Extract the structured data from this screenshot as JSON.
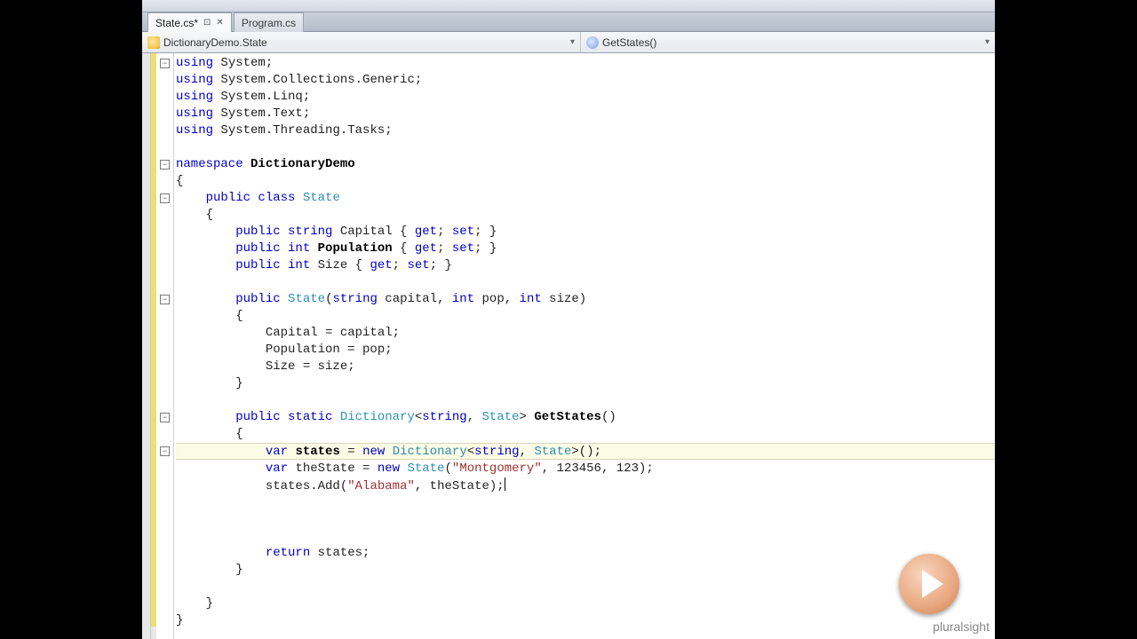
{
  "tabs": [
    {
      "label": "State.cs*",
      "active": true,
      "has_pin": true,
      "has_close": true
    },
    {
      "label": "Program.cs",
      "active": false,
      "has_pin": false,
      "has_close": false
    }
  ],
  "navbar": {
    "class_label": "DictionaryDemo.State",
    "member_label": "GetStates()"
  },
  "fold_rows": [
    0,
    6,
    8,
    14,
    21,
    23
  ],
  "changed_rows": [
    0,
    1,
    2,
    3,
    4,
    5,
    6,
    7,
    8,
    9,
    10,
    11,
    12,
    13,
    14,
    15,
    16,
    17,
    18,
    19,
    20,
    21,
    22,
    23,
    24,
    25,
    26,
    27,
    28,
    29,
    30,
    31,
    32,
    33
  ],
  "highlight_row": 23,
  "code_lines": [
    [
      [
        "kw",
        "using"
      ],
      [
        "",
        " System;"
      ]
    ],
    [
      [
        "kw",
        "using"
      ],
      [
        "",
        " System.Collections.Generic;"
      ]
    ],
    [
      [
        "kw",
        "using"
      ],
      [
        "",
        " System.Linq;"
      ]
    ],
    [
      [
        "kw",
        "using"
      ],
      [
        "",
        " System.Text;"
      ]
    ],
    [
      [
        "kw",
        "using"
      ],
      [
        "",
        " System.Threading.Tasks;"
      ]
    ],
    [
      [
        "",
        ""
      ]
    ],
    [
      [
        "kw",
        "namespace"
      ],
      [
        "",
        " "
      ],
      [
        "nm",
        "DictionaryDemo"
      ]
    ],
    [
      [
        "",
        "{"
      ]
    ],
    [
      [
        "",
        "    "
      ],
      [
        "kw",
        "public class"
      ],
      [
        "",
        " "
      ],
      [
        "type",
        "State"
      ]
    ],
    [
      [
        "",
        "    {"
      ]
    ],
    [
      [
        "",
        "        "
      ],
      [
        "kw",
        "public string"
      ],
      [
        "",
        " Capital { "
      ],
      [
        "kw",
        "get"
      ],
      [
        "",
        "; "
      ],
      [
        "kw",
        "set"
      ],
      [
        "",
        "; }"
      ]
    ],
    [
      [
        "",
        "        "
      ],
      [
        "kw",
        "public int"
      ],
      [
        "",
        " "
      ],
      [
        "nm",
        "Population"
      ],
      [
        "",
        " { "
      ],
      [
        "kw",
        "get"
      ],
      [
        "",
        "; "
      ],
      [
        "kw",
        "set"
      ],
      [
        "",
        "; }"
      ]
    ],
    [
      [
        "",
        "        "
      ],
      [
        "kw",
        "public int"
      ],
      [
        "",
        " Size { "
      ],
      [
        "kw",
        "get"
      ],
      [
        "",
        "; "
      ],
      [
        "kw",
        "set"
      ],
      [
        "",
        "; }"
      ]
    ],
    [
      [
        "",
        ""
      ]
    ],
    [
      [
        "",
        "        "
      ],
      [
        "kw",
        "public"
      ],
      [
        "",
        " "
      ],
      [
        "type",
        "State"
      ],
      [
        "",
        "("
      ],
      [
        "kw",
        "string"
      ],
      [
        "",
        " capital, "
      ],
      [
        "kw",
        "int"
      ],
      [
        "",
        " pop, "
      ],
      [
        "kw",
        "int"
      ],
      [
        "",
        " size)"
      ]
    ],
    [
      [
        "",
        "        {"
      ]
    ],
    [
      [
        "",
        "            Capital = capital;"
      ]
    ],
    [
      [
        "",
        "            Population = pop;"
      ]
    ],
    [
      [
        "",
        "            Size = size;"
      ]
    ],
    [
      [
        "",
        "        }"
      ]
    ],
    [
      [
        "",
        ""
      ]
    ],
    [
      [
        "",
        "        "
      ],
      [
        "kw",
        "public static"
      ],
      [
        "",
        " "
      ],
      [
        "type",
        "Dictionary"
      ],
      [
        "",
        "<"
      ],
      [
        "kw",
        "string"
      ],
      [
        "",
        ", "
      ],
      [
        "type",
        "State"
      ],
      [
        "",
        "> "
      ],
      [
        "nm",
        "GetStates"
      ],
      [
        "",
        "()"
      ]
    ],
    [
      [
        "",
        "        {"
      ]
    ],
    [
      [
        "",
        "            "
      ],
      [
        "kw",
        "var"
      ],
      [
        "",
        " "
      ],
      [
        "nm",
        "states"
      ],
      [
        "",
        " = "
      ],
      [
        "kw",
        "new"
      ],
      [
        "",
        " "
      ],
      [
        "type",
        "Dictionary"
      ],
      [
        "",
        "<"
      ],
      [
        "kw",
        "string"
      ],
      [
        "",
        ", "
      ],
      [
        "type",
        "State"
      ],
      [
        "",
        ">();"
      ]
    ],
    [
      [
        "",
        "            "
      ],
      [
        "kw",
        "var"
      ],
      [
        "",
        " theState = "
      ],
      [
        "kw",
        "new"
      ],
      [
        "",
        " "
      ],
      [
        "type",
        "State"
      ],
      [
        "",
        "("
      ],
      [
        "str",
        "\"Montgomery\""
      ],
      [
        "",
        ", 123456, 123);"
      ]
    ],
    [
      [
        "",
        "            states.Add("
      ],
      [
        "str",
        "\"Alabama\""
      ],
      [
        "",
        ", theState);"
      ]
    ],
    [
      [
        "",
        ""
      ]
    ],
    [
      [
        "",
        ""
      ]
    ],
    [
      [
        "",
        ""
      ]
    ],
    [
      [
        "",
        "            "
      ],
      [
        "kw",
        "return"
      ],
      [
        "",
        " states;"
      ]
    ],
    [
      [
        "",
        "        }"
      ]
    ],
    [
      [
        "",
        ""
      ]
    ],
    [
      [
        "",
        "    }"
      ]
    ],
    [
      [
        "",
        "}"
      ]
    ]
  ],
  "watermark_text": "pluralsight"
}
